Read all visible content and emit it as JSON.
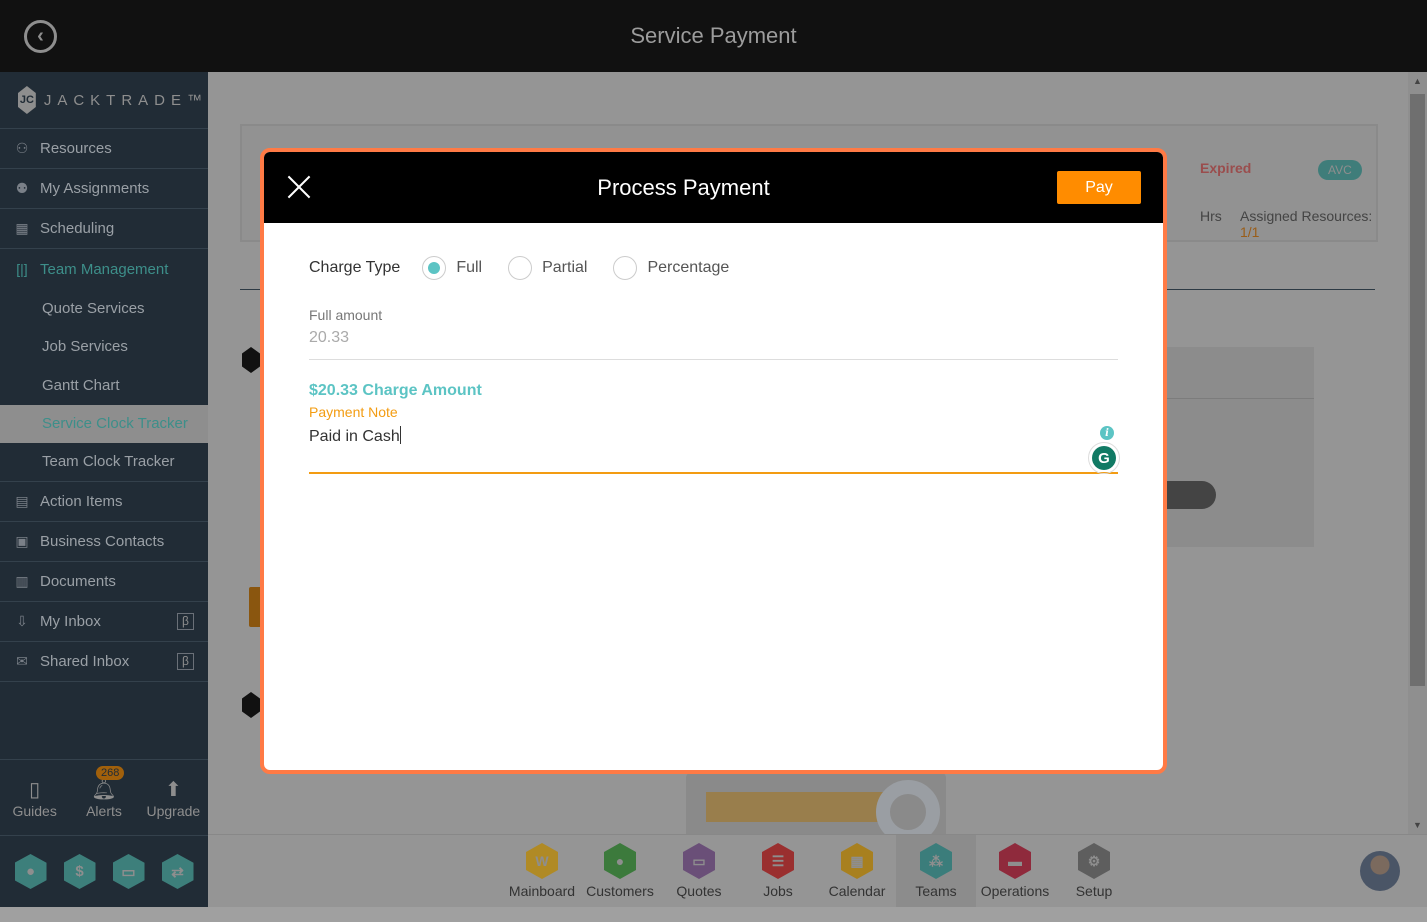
{
  "header": {
    "title": "Service Payment",
    "back_icon": "back-circle-icon"
  },
  "sidebar": {
    "logo_text": "JACKTRADE™",
    "items": [
      {
        "label": "Resources",
        "icon": "resources-icon"
      },
      {
        "label": "My Assignments",
        "icon": "assignments-icon"
      },
      {
        "label": "Scheduling",
        "icon": "calendar-clock-icon"
      },
      {
        "label": "Team Management",
        "icon": "bracket-icon",
        "active": true
      }
    ],
    "subitems": [
      {
        "label": "Quote Services"
      },
      {
        "label": "Job Services"
      },
      {
        "label": "Gantt Chart"
      },
      {
        "label": "Service Clock Tracker",
        "selected": true
      },
      {
        "label": "Team Clock Tracker"
      }
    ],
    "items2": [
      {
        "label": "Action Items",
        "icon": "clipboard-icon"
      },
      {
        "label": "Business Contacts",
        "icon": "contact-card-icon"
      },
      {
        "label": "Documents",
        "icon": "document-icon"
      },
      {
        "label": "My Inbox",
        "icon": "inbox-icon",
        "badge": "β"
      },
      {
        "label": "Shared Inbox",
        "icon": "envelope-icon",
        "badge": "β"
      }
    ],
    "tools": [
      {
        "label": "Guides",
        "icon": "book-icon"
      },
      {
        "label": "Alerts",
        "icon": "bell-icon",
        "count": "268"
      },
      {
        "label": "Upgrade",
        "icon": "arrow-up-icon"
      }
    ],
    "quick_icons": [
      "person-icon",
      "dollar-icon",
      "money-icon",
      "workflow-icon"
    ]
  },
  "background": {
    "status": "Expired",
    "tag": "AVC",
    "hrs_label": "Hrs",
    "assigned_label": "Assigned Resources:",
    "assigned_value": "1/1"
  },
  "modal": {
    "title": "Process Payment",
    "pay_label": "Pay",
    "charge_type_label": "Charge Type",
    "charge_options": [
      {
        "label": "Full",
        "checked": true
      },
      {
        "label": "Partial",
        "checked": false
      },
      {
        "label": "Percentage",
        "checked": false
      }
    ],
    "full_amount_label": "Full amount",
    "full_amount_value": "20.33",
    "charge_amount_text": "$20.33 Charge Amount",
    "payment_note_label": "Payment Note",
    "payment_note_value": "Paid in Cash"
  },
  "bottom_nav": [
    {
      "label": "Mainboard",
      "color": "#b08a25"
    },
    {
      "label": "Customers",
      "color": "#3c7a3c"
    },
    {
      "label": "Quotes",
      "color": "#6a4f78"
    },
    {
      "label": "Jobs",
      "color": "#9a2f2f"
    },
    {
      "label": "Calendar",
      "color": "#a8801f"
    },
    {
      "label": "Teams",
      "color": "#3b7d7b",
      "active": true
    },
    {
      "label": "Operations",
      "color": "#8f2a3c"
    },
    {
      "label": "Setup",
      "color": "#5e5e5e"
    }
  ]
}
